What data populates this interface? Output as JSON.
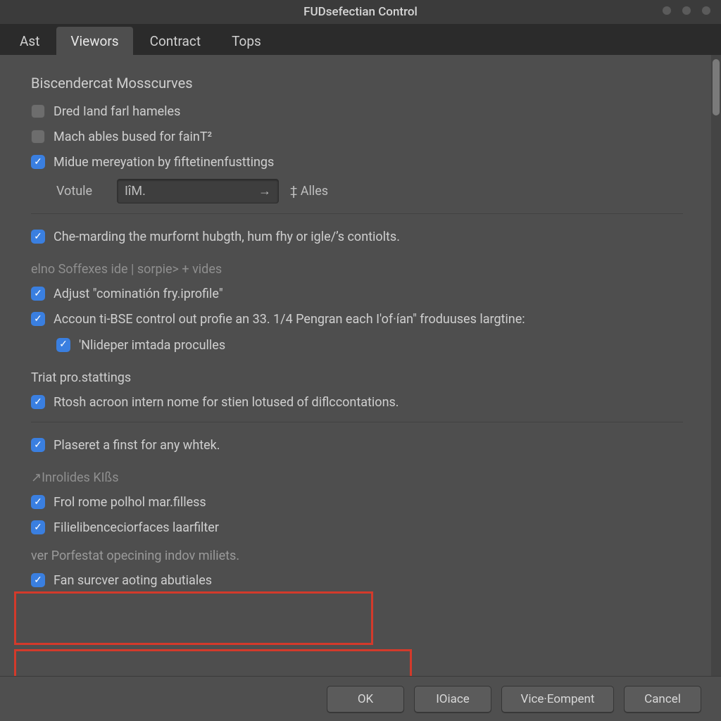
{
  "window": {
    "title": "FUDsefectian Control"
  },
  "tabs": [
    {
      "label": "Ast"
    },
    {
      "label": "Viewors"
    },
    {
      "label": "Contract"
    },
    {
      "label": "Tops"
    }
  ],
  "active_tab_index": 1,
  "section1": {
    "title": "Biscendercat Mosscurves",
    "items": [
      {
        "checked": false,
        "label": "Dred Iand farl hameles"
      },
      {
        "checked": false,
        "label": "Mach ables bused for fainT²"
      },
      {
        "checked": true,
        "label": "Midue mereyation by fiftetinenfusttings"
      }
    ],
    "input": {
      "label": "Votule",
      "value": "IîM.",
      "suffix": "‡ Alles"
    }
  },
  "row_che": {
    "checked": true,
    "label": "Che-marding the murfornt hubgth, hum fhy or igle/’s contiolts."
  },
  "section2": {
    "subhead": "elno Soffexes ide | sorpie> + vides",
    "items": [
      {
        "checked": true,
        "label": "Adjust \"cominatión fry.iprofile\""
      },
      {
        "checked": true,
        "label": "Accoun ti-BSE control out profie an 33. 1/4 Pengran each I'of·ían\" froduuses largtine:"
      }
    ],
    "nested": {
      "checked": true,
      "label": "'Nlideper imtada proculles"
    }
  },
  "section3": {
    "title": "Triat pro.stattings",
    "item": {
      "checked": true,
      "label": "Rtosh acroon intern nome for stien lotused of diflccontations."
    }
  },
  "section4": {
    "item": {
      "checked": true,
      "label": "Plaseret a finst for any whtek."
    },
    "subhead": "↗Inrolides KIßs",
    "h_items": [
      {
        "checked": true,
        "label": "Frol rome polhol mar.filless"
      },
      {
        "checked": true,
        "label": "Filielibenceciorfaces laarfilter"
      }
    ],
    "h2_sub": "ver Porfestat opecining indov miliets.",
    "h2_item": {
      "checked": true,
      "label": "Fan surcver aoting abutiales"
    }
  },
  "buttons": {
    "ok": "OK",
    "iface": "IOiace",
    "vice": "Vice·Eompent",
    "cancel": "Cancel"
  }
}
